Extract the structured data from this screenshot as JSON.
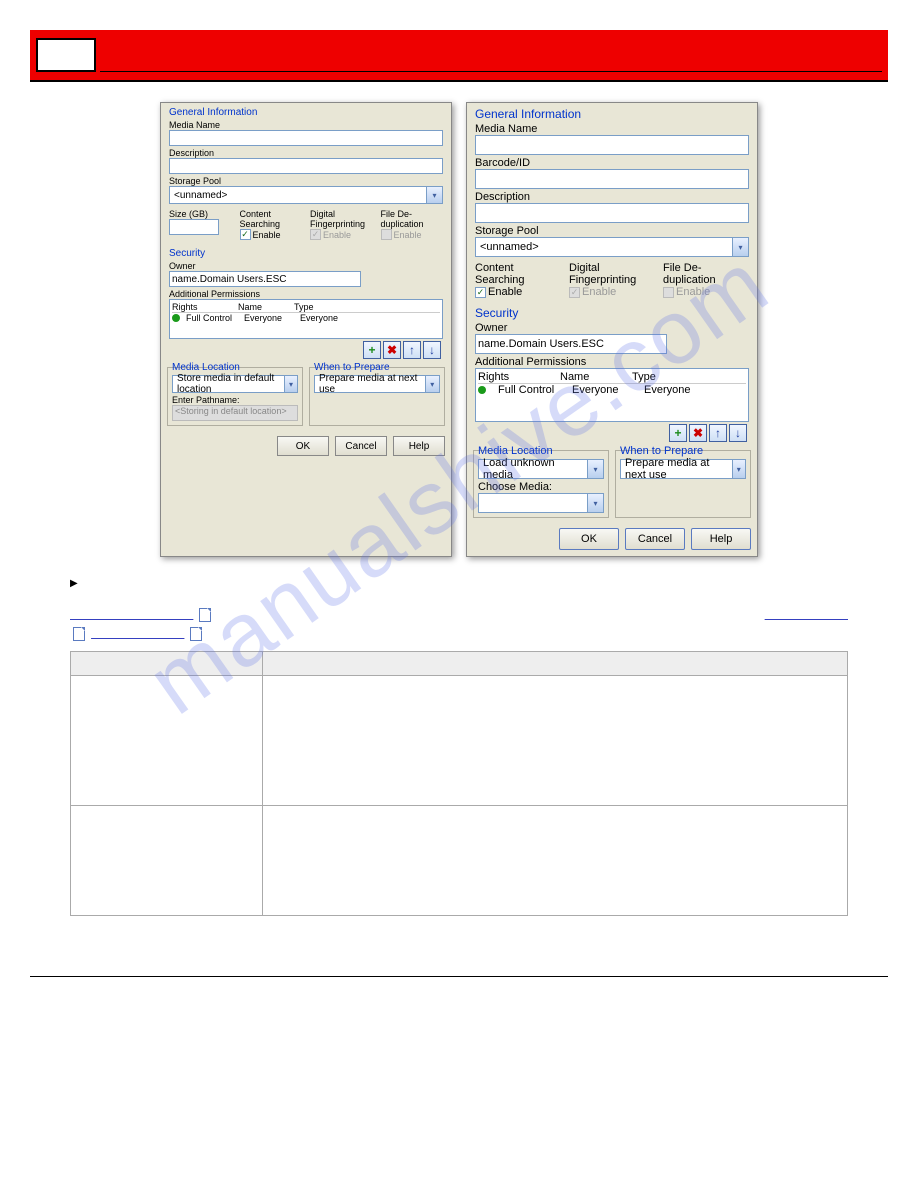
{
  "watermark": "manualshive.com",
  "left_dialog": {
    "general_information": "General Information",
    "media_name_label": "Media Name",
    "description_label": "Description",
    "storage_pool_label": "Storage Pool",
    "storage_pool_value": "<unnamed>",
    "size_label": "Size (GB)",
    "content_searching_label": "Content Searching",
    "digital_fingerprinting_label": "Digital Fingerprinting",
    "file_dedup_label": "File De-duplication",
    "enable_label": "Enable",
    "security_title": "Security",
    "owner_label": "Owner",
    "owner_value": "name.Domain Users.ESC",
    "additional_permissions_label": "Additional Permissions",
    "col_rights": "Rights",
    "col_name": "Name",
    "col_type": "Type",
    "perm_rights": "Full Control",
    "perm_name": "Everyone",
    "perm_type": "Everyone",
    "media_location_title": "Media Location",
    "media_location_value": "Store media in default location",
    "enter_pathname_label": "Enter Pathname:",
    "enter_pathname_value": "<Storing in default location>",
    "when_prepare_title": "When to Prepare",
    "when_prepare_value": "Prepare media at next use",
    "btn_ok": "OK",
    "btn_cancel": "Cancel",
    "btn_help": "Help"
  },
  "right_dialog": {
    "general_information": "General Information",
    "media_name_label": "Media Name",
    "barcode_label": "Barcode/ID",
    "description_label": "Description",
    "storage_pool_label": "Storage Pool",
    "storage_pool_value": "<unnamed>",
    "content_searching_label": "Content Searching",
    "digital_fingerprinting_label": "Digital Fingerprinting",
    "file_dedup_label": "File De-duplication",
    "enable_label": "Enable",
    "security_title": "Security",
    "owner_label": "Owner",
    "owner_value": "name.Domain Users.ESC",
    "additional_permissions_label": "Additional Permissions",
    "col_rights": "Rights",
    "col_name": "Name",
    "col_type": "Type",
    "perm_rights": "Full Control",
    "perm_name": "Everyone",
    "perm_type": "Everyone",
    "media_location_title": "Media Location",
    "media_location_value": "Load unknown media",
    "choose_media_label": "Choose Media:",
    "when_prepare_title": "When to Prepare",
    "when_prepare_value": "Prepare media at next use",
    "btn_ok": "OK",
    "btn_cancel": "Cancel",
    "btn_help": "Help"
  },
  "table": {
    "col1_header": "",
    "col2_header": ""
  }
}
